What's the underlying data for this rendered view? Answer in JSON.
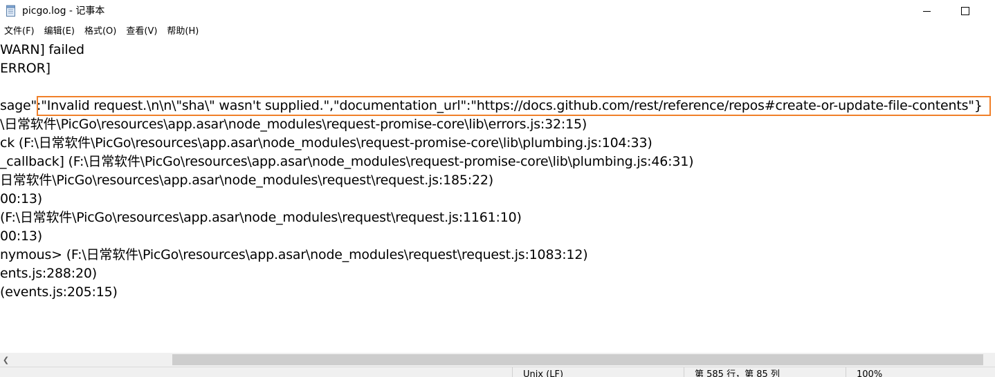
{
  "window": {
    "title": "picgo.log - 记事本",
    "icon": "notepad-icon"
  },
  "menu": {
    "items": [
      "文件(F)",
      "编辑(E)",
      "格式(O)",
      "查看(V)",
      "帮助(H)"
    ]
  },
  "editor": {
    "lines": [
      "WARN] failed",
      "ERROR]",
      "",
      "sage\":\"Invalid request.\\n\\n\\\"sha\\\" wasn't supplied.\",\"documentation_url\":\"https://docs.github.com/rest/reference/repos#create-or-update-file-contents\"}",
      "\\日常软件\\PicGo\\resources\\app.asar\\node_modules\\request-promise-core\\lib\\errors.js:32:15)",
      "ck (F:\\日常软件\\PicGo\\resources\\app.asar\\node_modules\\request-promise-core\\lib\\plumbing.js:104:33)",
      "_callback] (F:\\日常软件\\PicGo\\resources\\app.asar\\node_modules\\request-promise-core\\lib\\plumbing.js:46:31)",
      "日常软件\\PicGo\\resources\\app.asar\\node_modules\\request\\request.js:185:22)",
      "00:13)",
      "(F:\\日常软件\\PicGo\\resources\\app.asar\\node_modules\\request\\request.js:1161:10)",
      "00:13)",
      "nymous> (F:\\日常软件\\PicGo\\resources\\app.asar\\node_modules\\request\\request.js:1083:12)",
      "ents.js:288:20)",
      "(events.js:205:15)"
    ]
  },
  "status": {
    "eol": "Unix (LF)",
    "position": "第 585 行，第 85 列",
    "zoom": "100%"
  },
  "colors": {
    "highlight": "#f07f28",
    "chrome": "#f0f0f0",
    "scroll_thumb": "#cdcdcd"
  }
}
